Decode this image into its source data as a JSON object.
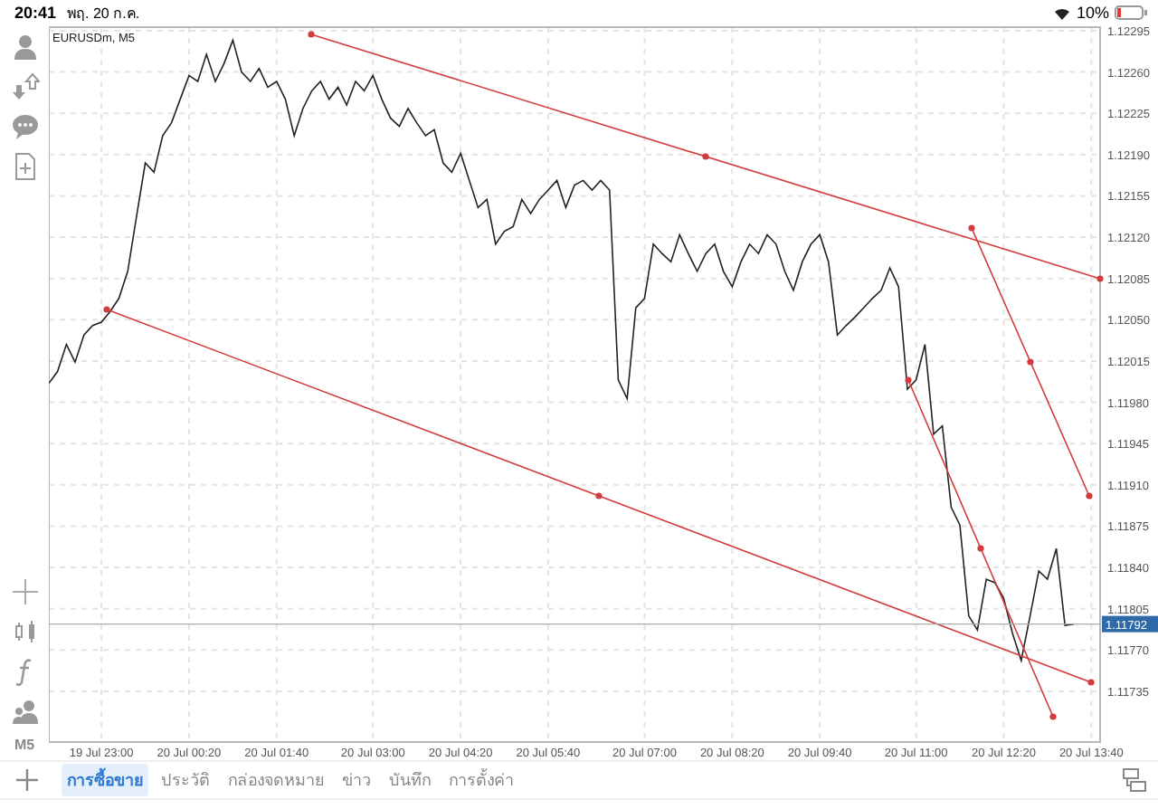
{
  "status_bar": {
    "time": "20:41",
    "date": "พฤ. 20 ก.ค.",
    "battery": "10%"
  },
  "toolbar": {
    "timeframe": "M5"
  },
  "chart": {
    "symbol": "EURUSDm, M5",
    "chart_data": {
      "type": "line",
      "grid": true,
      "ylim": [
        1.11692,
        1.12298
      ],
      "categories": [
        null,
        null,
        null,
        null,
        null,
        null,
        "19 Jul 23:00",
        null,
        null,
        null,
        null,
        null,
        null,
        null,
        null,
        null,
        "20 Jul 00:20",
        null,
        null,
        null,
        null,
        null,
        null,
        null,
        null,
        null,
        "20 Jul 01:40",
        null,
        null,
        null,
        null,
        null,
        null,
        null,
        null,
        null,
        null,
        "20 Jul 03:00",
        null,
        null,
        null,
        null,
        null,
        null,
        null,
        null,
        null,
        "20 Jul 04:20",
        null,
        null,
        null,
        null,
        null,
        null,
        null,
        null,
        null,
        "20 Jul 05:40",
        null,
        null,
        null,
        null,
        null,
        null,
        null,
        null,
        null,
        null,
        "20 Jul 07:00",
        null,
        null,
        null,
        null,
        null,
        null,
        null,
        null,
        null,
        "20 Jul 08:20",
        null,
        null,
        null,
        null,
        null,
        null,
        null,
        null,
        null,
        "20 Jul 09:40",
        null,
        null,
        null,
        null,
        null,
        null,
        null,
        null,
        null,
        null,
        "20 Jul 11:00",
        null,
        null,
        null,
        null,
        null,
        null,
        null,
        null,
        null,
        "20 Jul 12:20",
        null,
        null,
        null,
        null,
        null,
        null,
        null,
        null,
        null,
        "20 Jul 13:40"
      ],
      "yticks": [
        {
          "value": 1.12295,
          "label": "1.12295"
        },
        {
          "value": 1.1226,
          "label": "1.12260"
        },
        {
          "value": 1.12225,
          "label": "1.12225"
        },
        {
          "value": 1.1219,
          "label": "1.12190"
        },
        {
          "value": 1.12155,
          "label": "1.12155"
        },
        {
          "value": 1.1212,
          "label": "1.12120"
        },
        {
          "value": 1.12085,
          "label": "1.12085"
        },
        {
          "value": 1.1205,
          "label": "1.12050"
        },
        {
          "value": 1.12015,
          "label": "1.12015"
        },
        {
          "value": 1.1198,
          "label": "1.11980"
        },
        {
          "value": 1.11945,
          "label": "1.11945"
        },
        {
          "value": 1.1191,
          "label": "1.11910"
        },
        {
          "value": 1.11875,
          "label": "1.11875"
        },
        {
          "value": 1.1184,
          "label": "1.11840"
        },
        {
          "value": 1.11805,
          "label": "1.11805"
        },
        {
          "value": 1.1177,
          "label": "1.11770"
        },
        {
          "value": 1.11735,
          "label": "1.11735"
        }
      ],
      "series": [
        {
          "color": "#222222",
          "values": [
            1.11996,
            1.12006,
            1.12029,
            1.12014,
            1.12037,
            1.12045,
            1.12048,
            1.12057,
            1.12068,
            1.12091,
            1.12137,
            1.12183,
            1.12175,
            1.12206,
            1.12217,
            1.12237,
            1.12257,
            1.12252,
            1.12275,
            1.12252,
            1.12267,
            1.12287,
            1.1226,
            1.12252,
            1.12263,
            1.12247,
            1.12252,
            1.12237,
            1.12206,
            1.12229,
            1.12244,
            1.12252,
            1.12237,
            1.12247,
            1.12232,
            1.12252,
            1.12244,
            1.12257,
            1.12237,
            1.12221,
            1.12214,
            1.12229,
            1.12217,
            1.12206,
            1.12211,
            1.12183,
            1.12175,
            1.12191,
            1.12168,
            1.12145,
            1.12152,
            1.12114,
            1.12125,
            1.12129,
            1.12152,
            1.1214,
            1.12152,
            1.1216,
            1.12168,
            1.12145,
            1.12164,
            1.12168,
            1.1216,
            1.12168,
            1.1216,
            1.11999,
            1.11983,
            1.1206,
            1.12068,
            1.12114,
            1.12106,
            1.12099,
            1.12122,
            1.12106,
            1.12091,
            1.12106,
            1.12114,
            1.12091,
            1.12078,
            1.12099,
            1.12114,
            1.12106,
            1.12122,
            1.12114,
            1.12091,
            1.12075,
            1.12099,
            1.12114,
            1.12122,
            1.12099,
            1.12037,
            1.12045,
            1.12052,
            1.1206,
            1.12068,
            1.12075,
            1.12094,
            1.12078,
            1.11991,
            1.11999,
            1.12029,
            1.11953,
            1.1196,
            1.11891,
            1.11876,
            1.11799,
            1.11787,
            1.1183,
            1.11827,
            1.11814,
            1.11784,
            1.11761,
            1.11799,
            1.11837,
            1.1183,
            1.11856,
            1.11791,
            1.11792,
            null,
            null
          ]
        }
      ]
    },
    "current_price": "1.11792"
  },
  "tabs": [
    {
      "label": "การซื้อขาย",
      "selected": true
    },
    {
      "label": "ประวัติ",
      "selected": false
    },
    {
      "label": "กล่องจดหมาย",
      "selected": false
    },
    {
      "label": "ข่าว",
      "selected": false
    },
    {
      "label": "บันทึก",
      "selected": false
    },
    {
      "label": "การตั้งค่า",
      "selected": false
    }
  ]
}
